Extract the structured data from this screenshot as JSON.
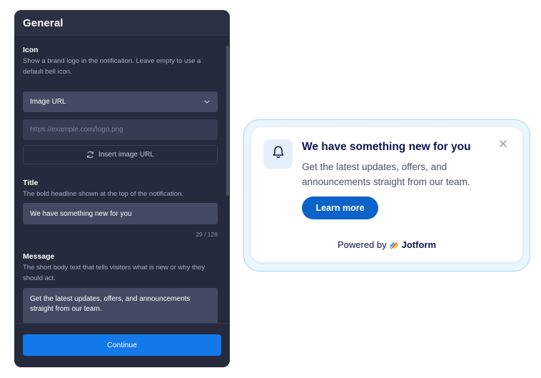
{
  "panel": {
    "title": "General",
    "icon_section": {
      "label": "Icon",
      "description": "Show a brand logo in the notification. Leave empty to use a default bell icon.",
      "select_value": "Image URL",
      "url_placeholder": "https://example.com/logo.png",
      "insert_button_label": "Insert image URL"
    },
    "title_section": {
      "label": "Title",
      "description": "The bold headline shown at the top of the notification.",
      "value": "We have something new for you",
      "counter": "29 / 128"
    },
    "message_section": {
      "label": "Message",
      "description": "The short body text that tells visitors what is new or why they should act.",
      "value": "Get the latest updates, offers, and announcements straight from our team."
    },
    "continue_label": "Continue"
  },
  "preview": {
    "icon": "bell-icon",
    "title": "We have something new for you",
    "message": "Get the latest updates, offers, and announcements straight from our team.",
    "button_label": "Learn more",
    "powered_prefix": "Powered by",
    "brand": "Jotform"
  },
  "colors": {
    "panel_bg": "#252a3c",
    "accent": "#1378ea",
    "cta": "#0b63c9",
    "heading": "#0a1551"
  }
}
